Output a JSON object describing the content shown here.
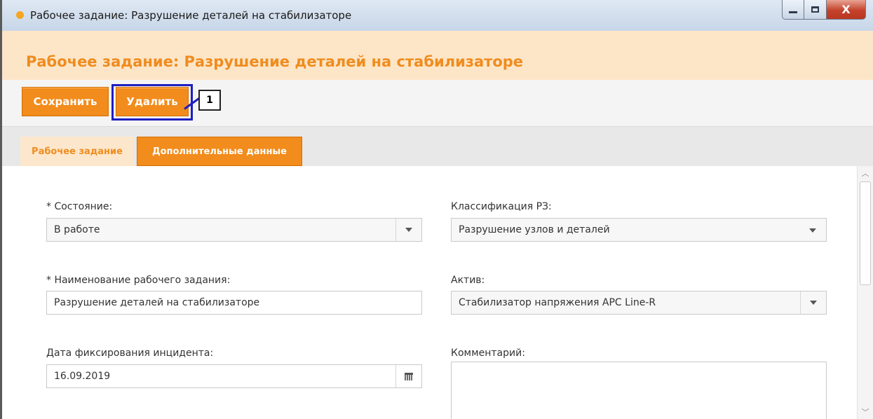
{
  "window": {
    "title": "Рабочее задание: Разрушение деталей на стабилизаторе",
    "close_glyph": "X"
  },
  "page": {
    "title": "Рабочее задание: Разрушение деталей на стабилизаторе"
  },
  "toolbar": {
    "save_label": "Сохранить",
    "delete_label": "Удалить",
    "callout_number": "1"
  },
  "tabs": [
    {
      "label": "Рабочее задание",
      "active": true
    },
    {
      "label": "Дополнительные данные",
      "active": false
    }
  ],
  "form": {
    "state": {
      "label": "* Состояние:",
      "value": "В работе"
    },
    "classification": {
      "label": "Классификация РЗ:",
      "value": "Разрушение узлов и деталей"
    },
    "name": {
      "label": "* Наименование рабочего задания:",
      "value": "Разрушение деталей на стабилизаторе"
    },
    "asset": {
      "label": "Актив:",
      "value": "Стабилизатор напряжения APC Line-R"
    },
    "incident_date": {
      "label": "Дата фиксирования инцидента:",
      "value": "16.09.2019"
    },
    "comment": {
      "label": "Комментарий:",
      "value": ""
    }
  },
  "icons": {
    "window_dot": "orange-dot-icon",
    "dropdown": "chevron-down-icon",
    "calendar": "calendar-icon",
    "scroll_up": "scroll-up-icon",
    "scroll_down": "scroll-down-icon"
  },
  "colors": {
    "accent": "#f28c1c",
    "title_text": "#f08c1e",
    "header_band": "#fde6c8",
    "highlight": "#1f1fbf"
  }
}
